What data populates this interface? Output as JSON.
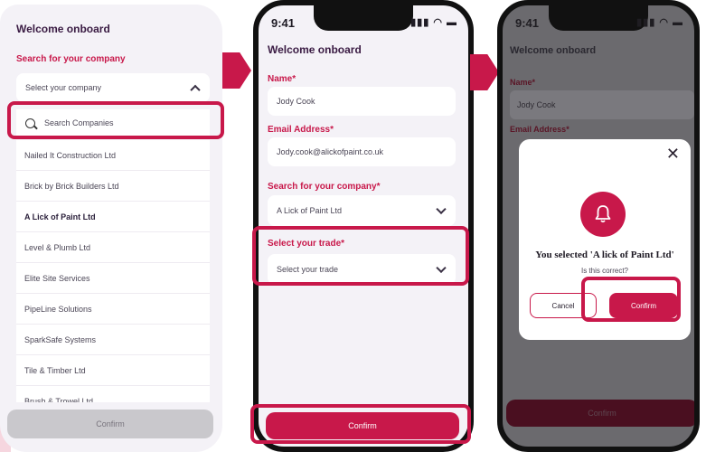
{
  "colors": {
    "accent": "#c8184a",
    "background": "#f4f2f7",
    "title": "#3a1b43"
  },
  "screen1": {
    "title": "Welcome onboard",
    "company_label": "Search for your company",
    "select_placeholder": "Select your company",
    "search_placeholder": "Search Companies",
    "companies": [
      "Nailed It Construction Ltd",
      "Brick by Brick Builders Ltd",
      "A Lick of Paint Ltd",
      "Level & Plumb Ltd",
      "Elite Site Services",
      "PipeLine Solutions",
      "SparkSafe Systems",
      "Tile & Timber Ltd",
      "Brush & Trowel Ltd"
    ],
    "confirm_label": "Confirm"
  },
  "screen2": {
    "time": "9:41",
    "title": "Welcome onboard",
    "name_label": "Name*",
    "name_value": "Jody Cook",
    "email_label": "Email Address*",
    "email_value": "Jody.cook@alickofpaint.co.uk",
    "company_label": "Search for your company*",
    "company_value": "A Lick of Paint Ltd",
    "trade_label": "Select your trade*",
    "trade_placeholder": "Select your trade",
    "confirm_label": "Confirm"
  },
  "screen3": {
    "time": "9:41",
    "title": "Welcome onboard",
    "name_label": "Name*",
    "name_value": "Jody Cook",
    "email_label": "Email Address*",
    "confirm_label": "Confirm",
    "modal": {
      "icon": "bell-icon",
      "heading": "You selected 'A lick of Paint Ltd'",
      "sub": "Is this correct?",
      "cancel_label": "Cancel",
      "confirm_label": "Confirm"
    }
  }
}
